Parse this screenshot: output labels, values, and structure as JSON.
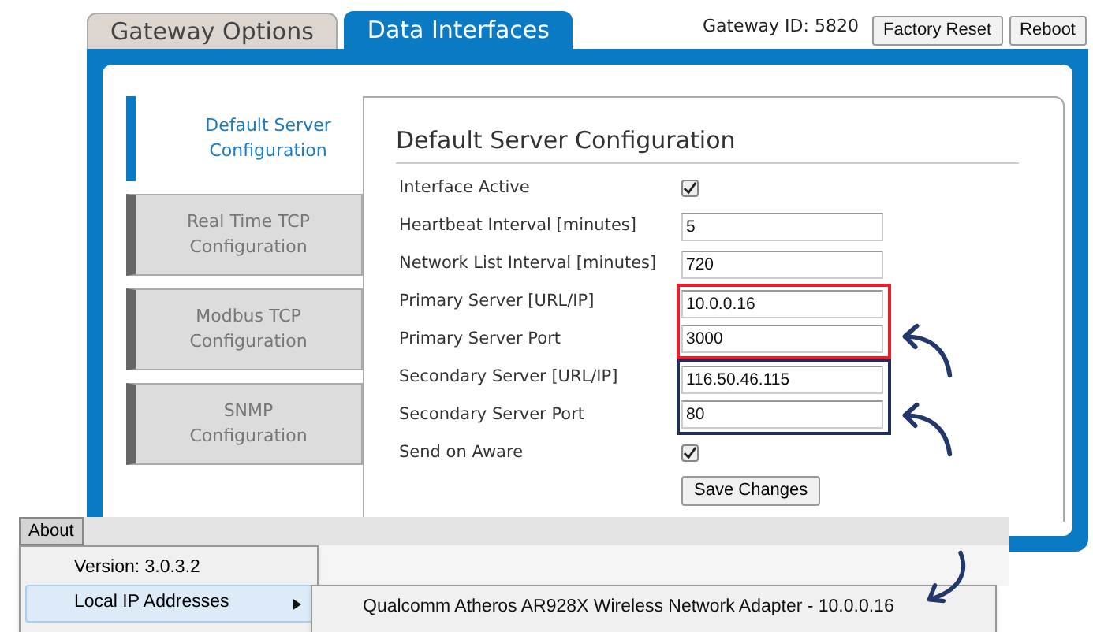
{
  "tabs": [
    {
      "label": "Gateway Options",
      "selected": false
    },
    {
      "label": "Data Interfaces",
      "selected": true
    }
  ],
  "gateway_id": "Gateway ID: 5820",
  "header_buttons": [
    "Factory Reset",
    "Reboot"
  ],
  "sidebar": {
    "items": [
      {
        "label": "Default Server Configuration",
        "selected": true
      },
      {
        "label": "Real Time TCP Configuration",
        "selected": false
      },
      {
        "label": "Modbus TCP Configuration",
        "selected": false
      },
      {
        "label": "SNMP Configuration",
        "selected": false
      }
    ]
  },
  "form": {
    "title": "Default Server Configuration",
    "fields": [
      {
        "kind": "checkbox",
        "label": "Interface Active",
        "checked": true
      },
      {
        "kind": "text",
        "label": "Heartbeat Interval [minutes]",
        "value": "5"
      },
      {
        "kind": "text",
        "label": "Network List Interval [minutes]",
        "value": "720"
      },
      {
        "kind": "text",
        "label": "Primary Server [URL/IP]",
        "value": "10.0.0.16",
        "color": "#e3202b"
      },
      {
        "kind": "text",
        "label": "Primary Server Port",
        "value": "3000",
        "color": "#e3202b"
      },
      {
        "kind": "text",
        "label": "Secondary Server [URL/IP]",
        "value": "116.50.46.115",
        "color": "#1f2f57"
      },
      {
        "kind": "text",
        "label": "Secondary Server Port",
        "value": "80",
        "color": "#1f2f57"
      },
      {
        "kind": "checkbox",
        "label": "Send on Aware",
        "checked": true
      }
    ],
    "save_button": "Save Changes"
  },
  "about_menu": {
    "label": "About",
    "items": [
      {
        "label": "Version: 3.0.3.2",
        "selected": false,
        "has_submenu": false
      },
      {
        "label": "Local IP Addresses",
        "selected": true,
        "has_submenu": true
      }
    ],
    "submenu": [
      "Qualcomm Atheros AR928X Wireless Network Adapter - 10.0.0.16"
    ]
  }
}
